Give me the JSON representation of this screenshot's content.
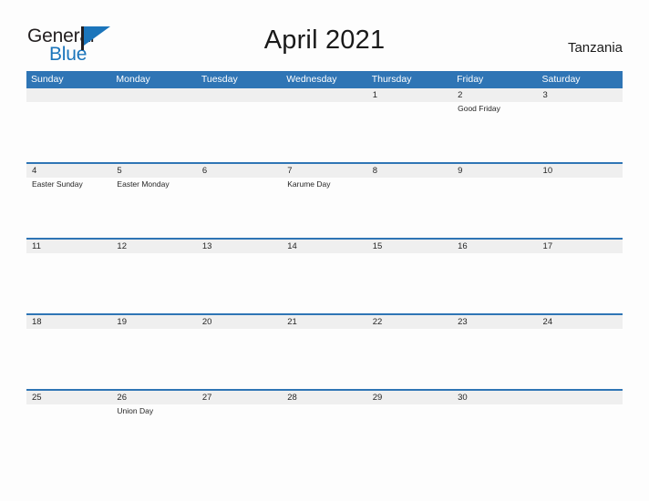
{
  "brand": {
    "word_one": "General",
    "word_two": "Blue",
    "flag_icon": "flag-triangle-icon"
  },
  "header": {
    "title": "April 2021",
    "locale": "Tanzania"
  },
  "calendar": {
    "accent_color": "#2f75b5",
    "date_band_color": "#efefef",
    "day_headers": [
      "Sunday",
      "Monday",
      "Tuesday",
      "Wednesday",
      "Thursday",
      "Friday",
      "Saturday"
    ],
    "weeks": [
      {
        "days": [
          {
            "date": "",
            "event": ""
          },
          {
            "date": "",
            "event": ""
          },
          {
            "date": "",
            "event": ""
          },
          {
            "date": "",
            "event": ""
          },
          {
            "date": "1",
            "event": ""
          },
          {
            "date": "2",
            "event": "Good Friday"
          },
          {
            "date": "3",
            "event": ""
          }
        ]
      },
      {
        "days": [
          {
            "date": "4",
            "event": "Easter Sunday"
          },
          {
            "date": "5",
            "event": "Easter Monday"
          },
          {
            "date": "6",
            "event": ""
          },
          {
            "date": "7",
            "event": "Karume Day"
          },
          {
            "date": "8",
            "event": ""
          },
          {
            "date": "9",
            "event": ""
          },
          {
            "date": "10",
            "event": ""
          }
        ]
      },
      {
        "days": [
          {
            "date": "11",
            "event": ""
          },
          {
            "date": "12",
            "event": ""
          },
          {
            "date": "13",
            "event": ""
          },
          {
            "date": "14",
            "event": ""
          },
          {
            "date": "15",
            "event": ""
          },
          {
            "date": "16",
            "event": ""
          },
          {
            "date": "17",
            "event": ""
          }
        ]
      },
      {
        "days": [
          {
            "date": "18",
            "event": ""
          },
          {
            "date": "19",
            "event": ""
          },
          {
            "date": "20",
            "event": ""
          },
          {
            "date": "21",
            "event": ""
          },
          {
            "date": "22",
            "event": ""
          },
          {
            "date": "23",
            "event": ""
          },
          {
            "date": "24",
            "event": ""
          }
        ]
      },
      {
        "days": [
          {
            "date": "25",
            "event": ""
          },
          {
            "date": "26",
            "event": "Union Day"
          },
          {
            "date": "27",
            "event": ""
          },
          {
            "date": "28",
            "event": ""
          },
          {
            "date": "29",
            "event": ""
          },
          {
            "date": "30",
            "event": ""
          },
          {
            "date": "",
            "event": ""
          }
        ]
      }
    ]
  }
}
